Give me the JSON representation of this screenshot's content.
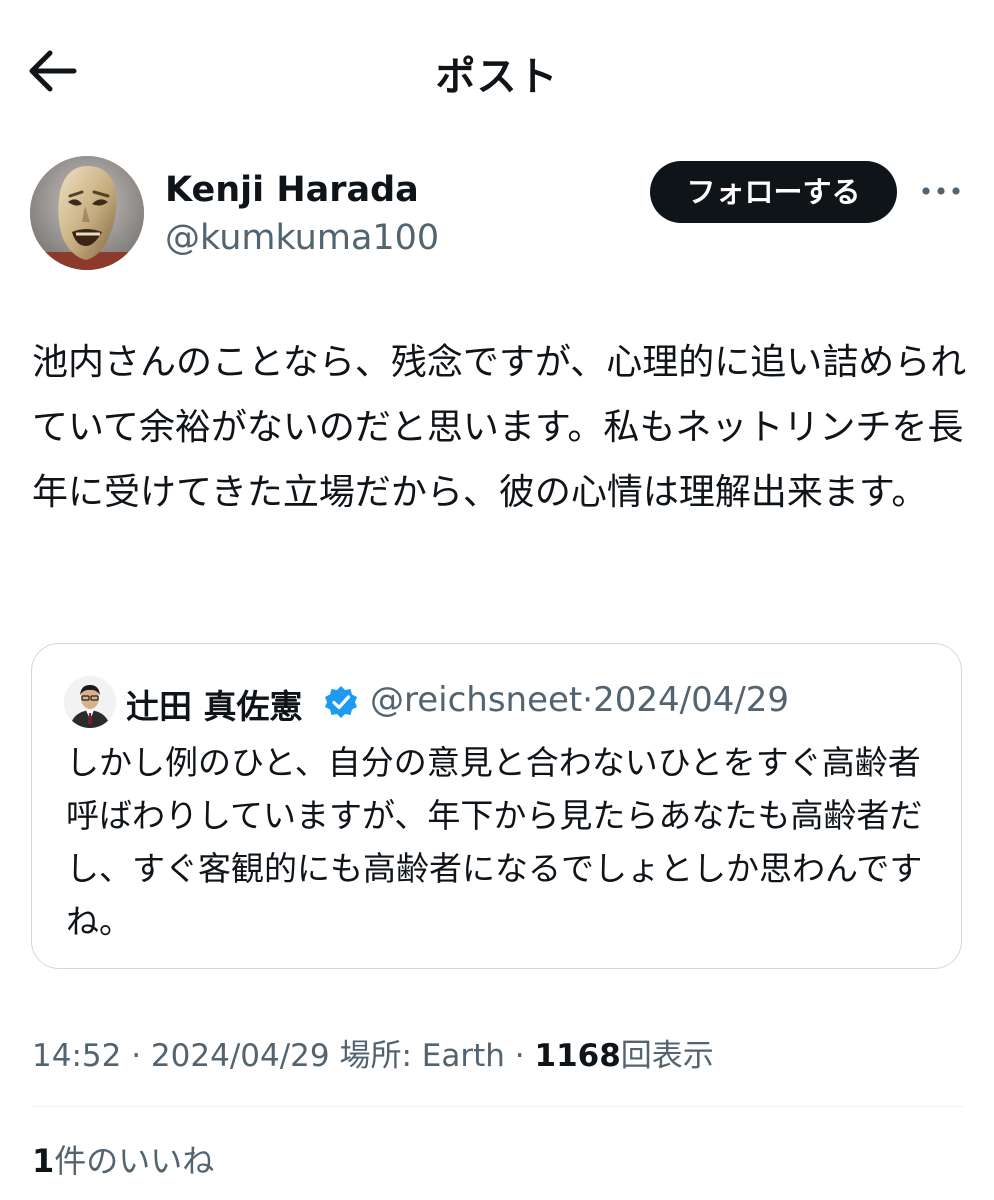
{
  "header": {
    "title": "ポスト",
    "back_icon": "arrow-left-icon"
  },
  "author": {
    "name": "Kenji Harada",
    "handle": "@kumkuma100",
    "follow_label": "フォローする",
    "more_icon": "more-horizontal-icon"
  },
  "post": {
    "text": "池内さんのことなら、残念ですが、心理的に追い詰められていて余裕がないのだと思います。私もネットリンチを長年に受けてきた立場だから、彼の心情は理解出来ます。"
  },
  "quote": {
    "name": "辻田 真佐憲",
    "verified_icon": "verified-badge-icon",
    "handle": "@reichsneet",
    "separator": "·",
    "date": "2024/04/29",
    "text": "しかし例のひと、自分の意見と合わないひとをすぐ高齢者呼ばわりしていますが、年下から見たらあなたも高齢者だし、すぐ客観的にも高齢者になるでしょとしか思わんですね。"
  },
  "meta": {
    "time": "14:52",
    "separator": "·",
    "date": "2024/04/29",
    "location_label": "場所:",
    "location_value": "Earth",
    "view_count": "1168",
    "views_label": "回表示"
  },
  "likes": {
    "count": "1",
    "label": "件のいいね"
  },
  "colors": {
    "text": "#0f1419",
    "secondary": "#536471",
    "border": "#cfd9de",
    "verified": "#1d9bf0"
  }
}
